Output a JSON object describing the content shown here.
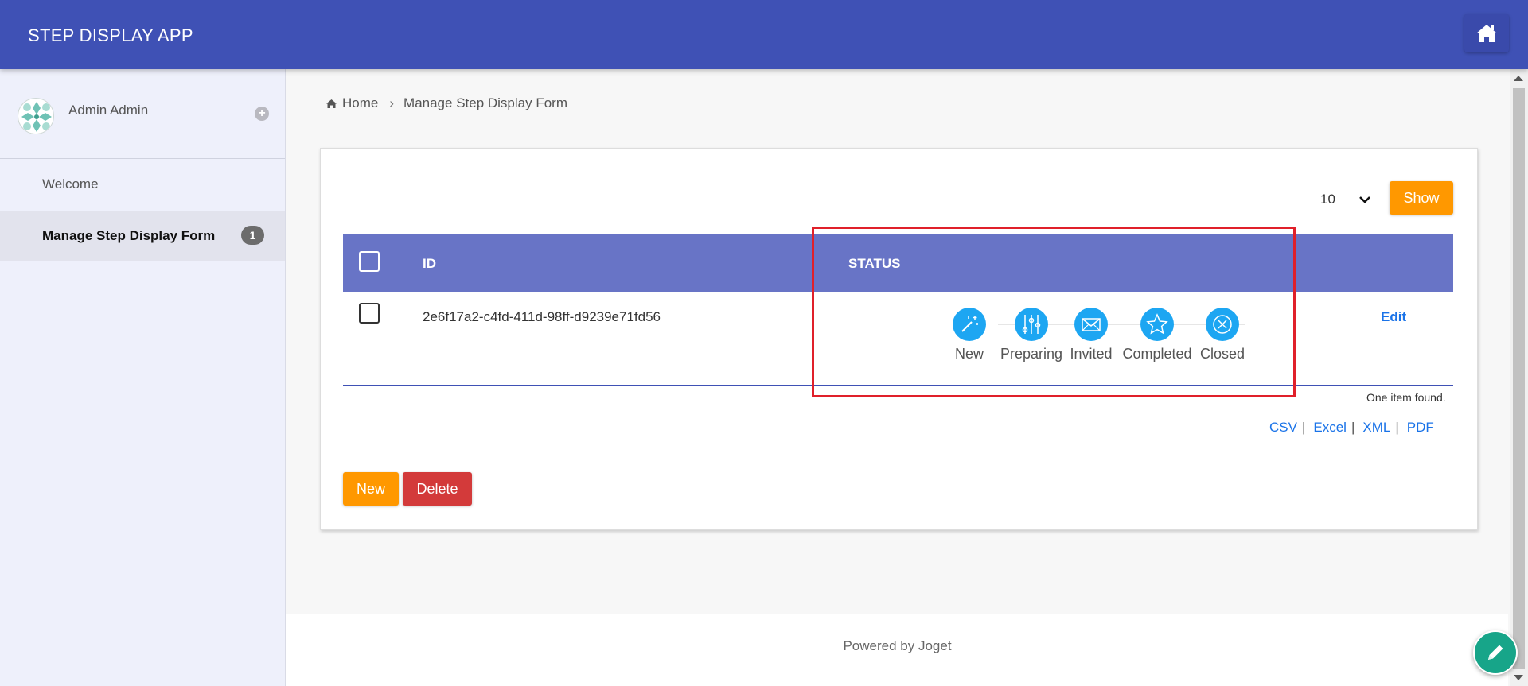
{
  "header": {
    "app_title": "STEP DISPLAY APP",
    "home_icon": "home-icon",
    "color": "#3f51b5"
  },
  "sidebar": {
    "user_name": "Admin Admin",
    "items": [
      {
        "label": "Welcome"
      },
      {
        "label": "Manage Step Display Form",
        "badge": "1"
      }
    ]
  },
  "breadcrumb": {
    "home": "Home",
    "current": "Manage Step Display Form"
  },
  "list": {
    "page_size": "10",
    "show_label": "Show",
    "columns": [
      "ID",
      "STATUS"
    ],
    "rows": [
      {
        "id": "2e6f17a2-c4fd-411d-98ff-d9239e71fd56",
        "steps": [
          {
            "label": "New",
            "icon": "magic-wand-icon"
          },
          {
            "label": "Preparing",
            "icon": "sliders-icon"
          },
          {
            "label": "Invited",
            "icon": "envelope-icon"
          },
          {
            "label": "Completed",
            "icon": "star-icon"
          },
          {
            "label": "Closed",
            "icon": "close-circle-icon"
          }
        ],
        "action": "Edit"
      }
    ],
    "count_text": "One item found.",
    "exports": [
      "CSV",
      "Excel",
      "XML",
      "PDF"
    ],
    "new_label": "New",
    "delete_label": "Delete"
  },
  "footer": {
    "text": "Powered by Joget"
  },
  "colors": {
    "accent": "#3f51b5",
    "table_header": "#6874c6",
    "orange": "#ff9800",
    "red": "#d33a3a",
    "step": "#1da6f2",
    "highlight": "#e0202a"
  }
}
